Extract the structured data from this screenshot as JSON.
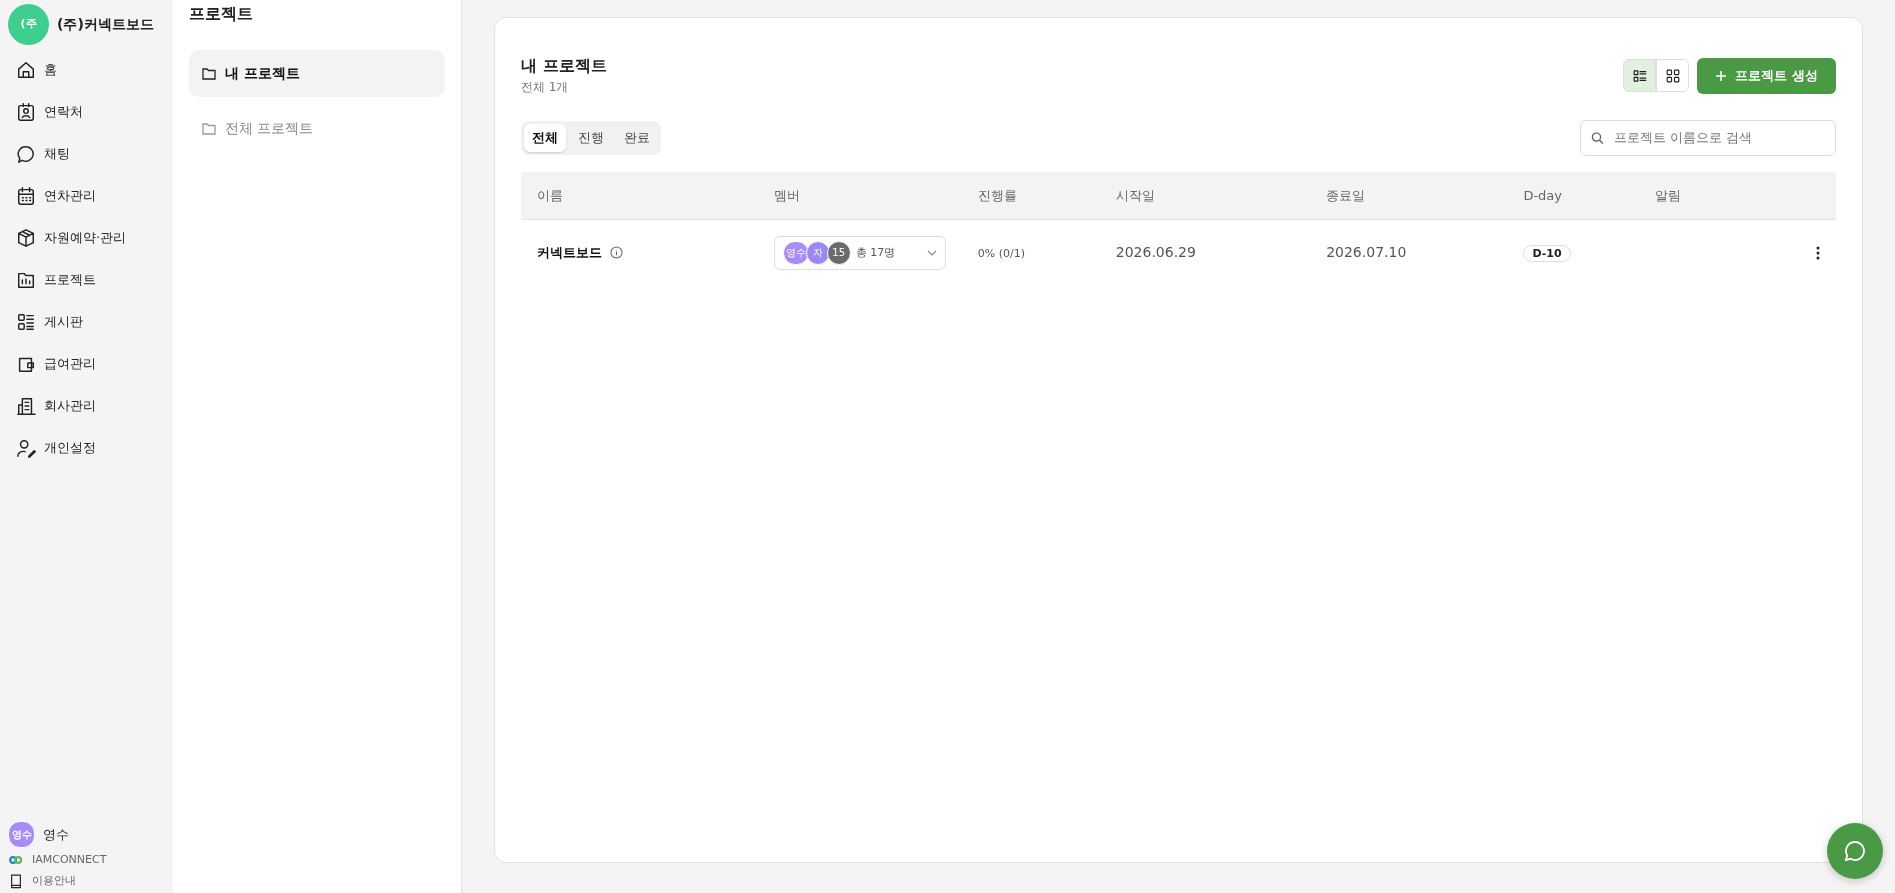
{
  "company": {
    "logo": "(주",
    "name": "(주)커넥트보드"
  },
  "nav": [
    {
      "kind": "home",
      "label": "홈"
    },
    {
      "kind": "contact",
      "label": "연락처"
    },
    {
      "kind": "chat",
      "label": "채팅"
    },
    {
      "kind": "calendar",
      "label": "연차관리"
    },
    {
      "kind": "box",
      "label": "자원예약·관리"
    },
    {
      "kind": "project",
      "label": "프로젝트"
    },
    {
      "kind": "board",
      "label": "게시판"
    },
    {
      "kind": "wallet",
      "label": "급여관리"
    },
    {
      "kind": "building",
      "label": "회사관리"
    },
    {
      "kind": "user",
      "label": "개인설정"
    }
  ],
  "user": {
    "avatar": "영수",
    "name": "영수"
  },
  "footer": [
    {
      "kind": "brand",
      "label": "IAMCONNECT"
    },
    {
      "kind": "guide",
      "label": "이용안내"
    }
  ],
  "subnav": {
    "title": "프로젝트",
    "items": [
      {
        "label": "내 프로젝트",
        "selected": true
      },
      {
        "label": "전체 프로젝트",
        "selected": false
      }
    ]
  },
  "main": {
    "title": "내 프로젝트",
    "count": "전체 1개",
    "views": [
      {
        "kind": "list",
        "selected": true
      },
      {
        "kind": "grid",
        "selected": false
      }
    ],
    "create_button": "프로젝트 생성",
    "filters": [
      {
        "label": "전체",
        "selected": true
      },
      {
        "label": "진행",
        "selected": false
      },
      {
        "label": "완료",
        "selected": false
      }
    ],
    "search": {
      "placeholder": "프로젝트 이름으로 검색"
    },
    "table": {
      "columns": [
        "이름",
        "멤버",
        "진행률",
        "시작일",
        "종료일",
        "D-day",
        "알림"
      ],
      "rows": [
        {
          "name": "커넥트보드",
          "members": [
            {
              "label": "영수",
              "color": "#a78bfa"
            },
            {
              "label": "자",
              "color": "#9b87f5"
            },
            {
              "label": "15",
              "color": "#6b6b6b"
            }
          ],
          "member_total": "총 17명",
          "progress": "0% (0/1)",
          "start": "2026.06.29",
          "end": "2026.07.10",
          "dday": "D-10"
        }
      ]
    }
  }
}
